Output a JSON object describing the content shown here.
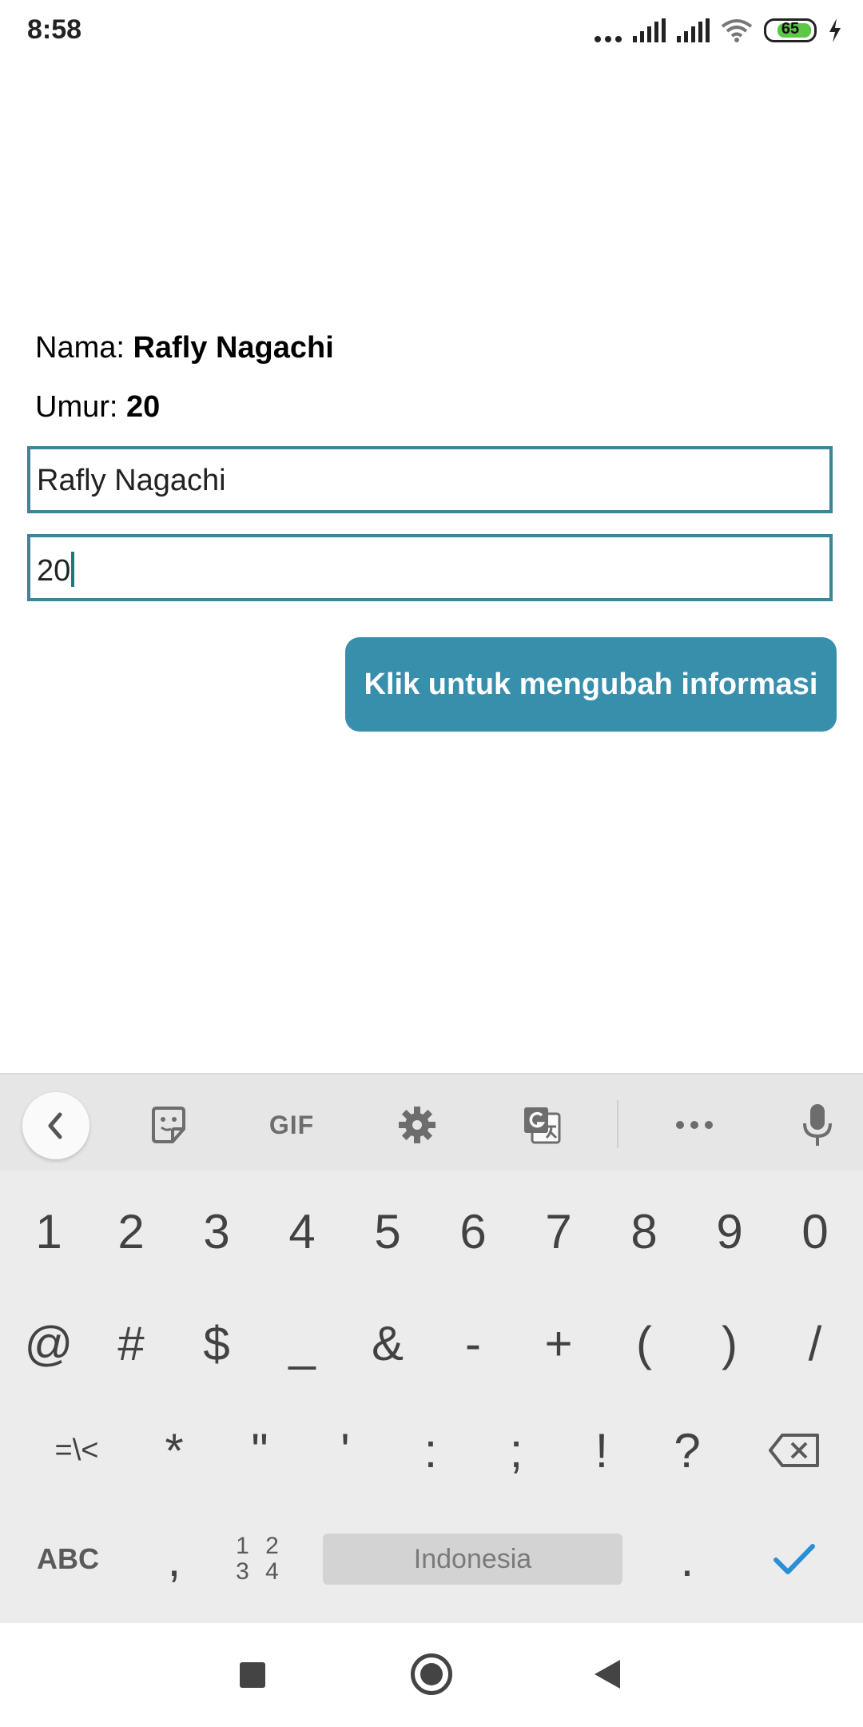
{
  "status_bar": {
    "time": "8:58",
    "battery": "65",
    "icons": [
      "more-dots-icon",
      "signal-icon",
      "signal-icon",
      "wifi-icon",
      "battery-icon",
      "charging-icon"
    ]
  },
  "profile": {
    "name_label": "Nama: ",
    "name_value": "Rafly Nagachi",
    "age_label": "Umur: ",
    "age_value": "20"
  },
  "form": {
    "name_input_value": "Rafly Nagachi",
    "age_input_value": "20",
    "submit_label": "Klik untuk mengubah informasi"
  },
  "keyboard": {
    "toolbar": {
      "gif_label": "GIF",
      "icons": [
        "back-icon",
        "sticker-icon",
        "gif-icon",
        "settings-icon",
        "translate-icon",
        "more-icon",
        "mic-icon"
      ]
    },
    "row1": [
      "1",
      "2",
      "3",
      "4",
      "5",
      "6",
      "7",
      "8",
      "9",
      "0"
    ],
    "row2": [
      "@",
      "#",
      "$",
      "_",
      "&",
      "-",
      "+",
      "(",
      ")",
      "/"
    ],
    "row3": [
      "=\\<",
      "*",
      "\"",
      "'",
      ":",
      ";",
      "!",
      "?"
    ],
    "abc_label": "ABC",
    "comma": ",",
    "nums_line1": "1 2",
    "nums_line2": "3 4",
    "space_label": "Indonesia",
    "period": "."
  },
  "colors": {
    "accent": "#378fac",
    "field_border": "#3a8596",
    "check": "#2a8fd6"
  }
}
